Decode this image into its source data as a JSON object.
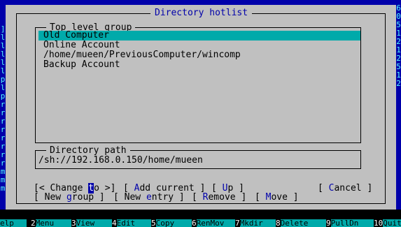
{
  "dialog": {
    "title": "Directory hotlist",
    "group_title": "Top level group",
    "path_title": "Directory path",
    "path_value": "/sh://192.168.0.150/home/mueen"
  },
  "hotlist": [
    {
      "label": "Old Computer",
      "selected": true
    },
    {
      "label": "Online Account",
      "selected": false
    },
    {
      "label": "/home/mueen/PreviousComputer/wincomp",
      "selected": false
    },
    {
      "label": "Backup Account",
      "selected": false
    }
  ],
  "buttons": {
    "change_to_pre": "[< Change ",
    "change_to_hot": "t",
    "change_to_post": "o >]",
    "add_current_pre": "[ ",
    "add_current_hot": "A",
    "add_current_post": "dd current ]",
    "up_pre": "[ ",
    "up_hot": "U",
    "up_post": "p ]",
    "cancel_pre": "[ ",
    "cancel_hot": "C",
    "cancel_post": "ancel ]",
    "new_group_pre": "[ New ",
    "new_group_hot": "g",
    "new_group_post": "roup ]",
    "new_entry_pre": "[ New ",
    "new_entry_hot": "e",
    "new_entry_post": "ntry ]",
    "remove_pre": "[ ",
    "remove_hot": "R",
    "remove_post": "emove ]",
    "move_pre": "[ ",
    "move_hot": "M",
    "move_post": "ove ]"
  },
  "left_panel_glyphs": [
    "]",
    "l",
    "l",
    "l",
    "l",
    "l",
    "p",
    "l",
    "p",
    "r",
    "r",
    "r",
    "r",
    "r",
    "r",
    "r",
    "r",
    "m",
    "m",
    "m"
  ],
  "right_panel_glyphs": [
    "6",
    "0",
    "5",
    "1",
    "2",
    "1",
    "2",
    "5",
    "1",
    "2"
  ],
  "function_keys": [
    {
      "num": "",
      "label": "elp"
    },
    {
      "num": "2",
      "label": "Menu"
    },
    {
      "num": "3",
      "label": "View"
    },
    {
      "num": "4",
      "label": "Edit"
    },
    {
      "num": "5",
      "label": "Copy"
    },
    {
      "num": "6",
      "label": "RenMov"
    },
    {
      "num": "7",
      "label": "Mkdir"
    },
    {
      "num": "8",
      "label": "Delete"
    },
    {
      "num": "9",
      "label": "PullDn"
    },
    {
      "num": "10",
      "label": "Quit"
    }
  ],
  "colors": {
    "background": "#0000aa",
    "dialog": "#c0c0c0",
    "selection": "#00aaaa",
    "title_text": "#0000aa"
  }
}
